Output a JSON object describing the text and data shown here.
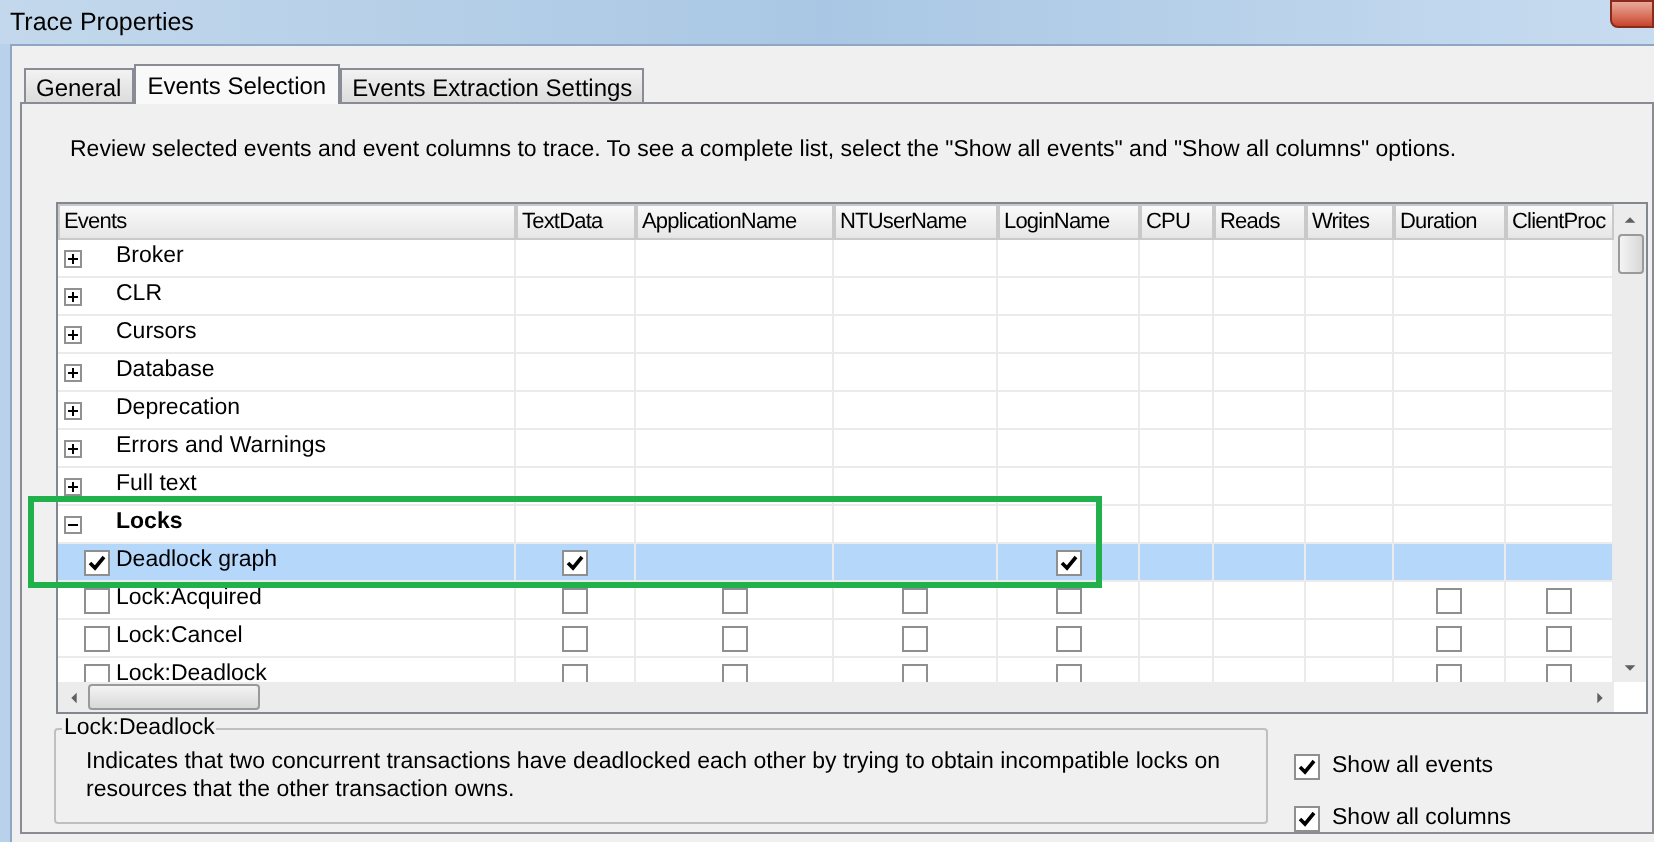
{
  "window": {
    "title": "Trace Properties"
  },
  "tabs": [
    {
      "label": "General",
      "selected": false
    },
    {
      "label": "Events Selection",
      "selected": true
    },
    {
      "label": "Events Extraction Settings",
      "selected": false
    }
  ],
  "instructions": "Review selected events and event columns to trace. To see a complete list, select the \"Show all events\" and \"Show all columns\" options.",
  "table": {
    "columns": [
      "Events",
      "TextData",
      "ApplicationName",
      "NTUserName",
      "LoginName",
      "CPU",
      "Reads",
      "Writes",
      "Duration",
      "ClientProc"
    ],
    "rows": [
      {
        "kind": "category",
        "label": "Broker",
        "expanded": false
      },
      {
        "kind": "category",
        "label": "CLR",
        "expanded": false
      },
      {
        "kind": "category",
        "label": "Cursors",
        "expanded": false
      },
      {
        "kind": "category",
        "label": "Database",
        "expanded": false
      },
      {
        "kind": "category",
        "label": "Deprecation",
        "expanded": false
      },
      {
        "kind": "category",
        "label": "Errors and Warnings",
        "expanded": false
      },
      {
        "kind": "category",
        "label": "Full text",
        "expanded": false
      },
      {
        "kind": "category",
        "label": "Locks",
        "expanded": true
      },
      {
        "kind": "event",
        "label": "Deadlock graph",
        "checked": true,
        "selected": true,
        "cells": [
          {
            "kind": "checkbox",
            "checked": true
          },
          {
            "kind": "empty"
          },
          {
            "kind": "empty"
          },
          {
            "kind": "checkbox",
            "checked": true
          },
          {
            "kind": "empty"
          },
          {
            "kind": "empty"
          },
          {
            "kind": "empty"
          },
          {
            "kind": "empty"
          },
          {
            "kind": "empty"
          }
        ]
      },
      {
        "kind": "event",
        "label": "Lock:Acquired",
        "checked": false,
        "selected": false,
        "cells": [
          {
            "kind": "checkbox",
            "checked": false
          },
          {
            "kind": "checkbox",
            "checked": false
          },
          {
            "kind": "checkbox",
            "checked": false
          },
          {
            "kind": "checkbox",
            "checked": false
          },
          {
            "kind": "empty"
          },
          {
            "kind": "empty"
          },
          {
            "kind": "empty"
          },
          {
            "kind": "checkbox",
            "checked": false
          },
          {
            "kind": "checkbox",
            "checked": false
          }
        ]
      },
      {
        "kind": "event",
        "label": "Lock:Cancel",
        "checked": false,
        "selected": false,
        "cells": [
          {
            "kind": "checkbox",
            "checked": false
          },
          {
            "kind": "checkbox",
            "checked": false
          },
          {
            "kind": "checkbox",
            "checked": false
          },
          {
            "kind": "checkbox",
            "checked": false
          },
          {
            "kind": "empty"
          },
          {
            "kind": "empty"
          },
          {
            "kind": "empty"
          },
          {
            "kind": "checkbox",
            "checked": false
          },
          {
            "kind": "checkbox",
            "checked": false
          }
        ]
      },
      {
        "kind": "event",
        "label": "Lock:Deadlock",
        "checked": false,
        "selected": false,
        "cells": [
          {
            "kind": "checkbox",
            "checked": false
          },
          {
            "kind": "checkbox",
            "checked": false
          },
          {
            "kind": "checkbox",
            "checked": false
          },
          {
            "kind": "checkbox",
            "checked": false
          },
          {
            "kind": "empty"
          },
          {
            "kind": "empty"
          },
          {
            "kind": "empty"
          },
          {
            "kind": "checkbox",
            "checked": false
          },
          {
            "kind": "checkbox",
            "checked": false
          }
        ]
      }
    ]
  },
  "description": {
    "title": "Lock:Deadlock",
    "text": "Indicates that two concurrent transactions have deadlocked each other by trying to obtain incompatible locks on resources that the other transaction owns."
  },
  "options": [
    {
      "label": "Show all events",
      "checked": true
    },
    {
      "label": "Show all columns",
      "checked": true
    }
  ]
}
